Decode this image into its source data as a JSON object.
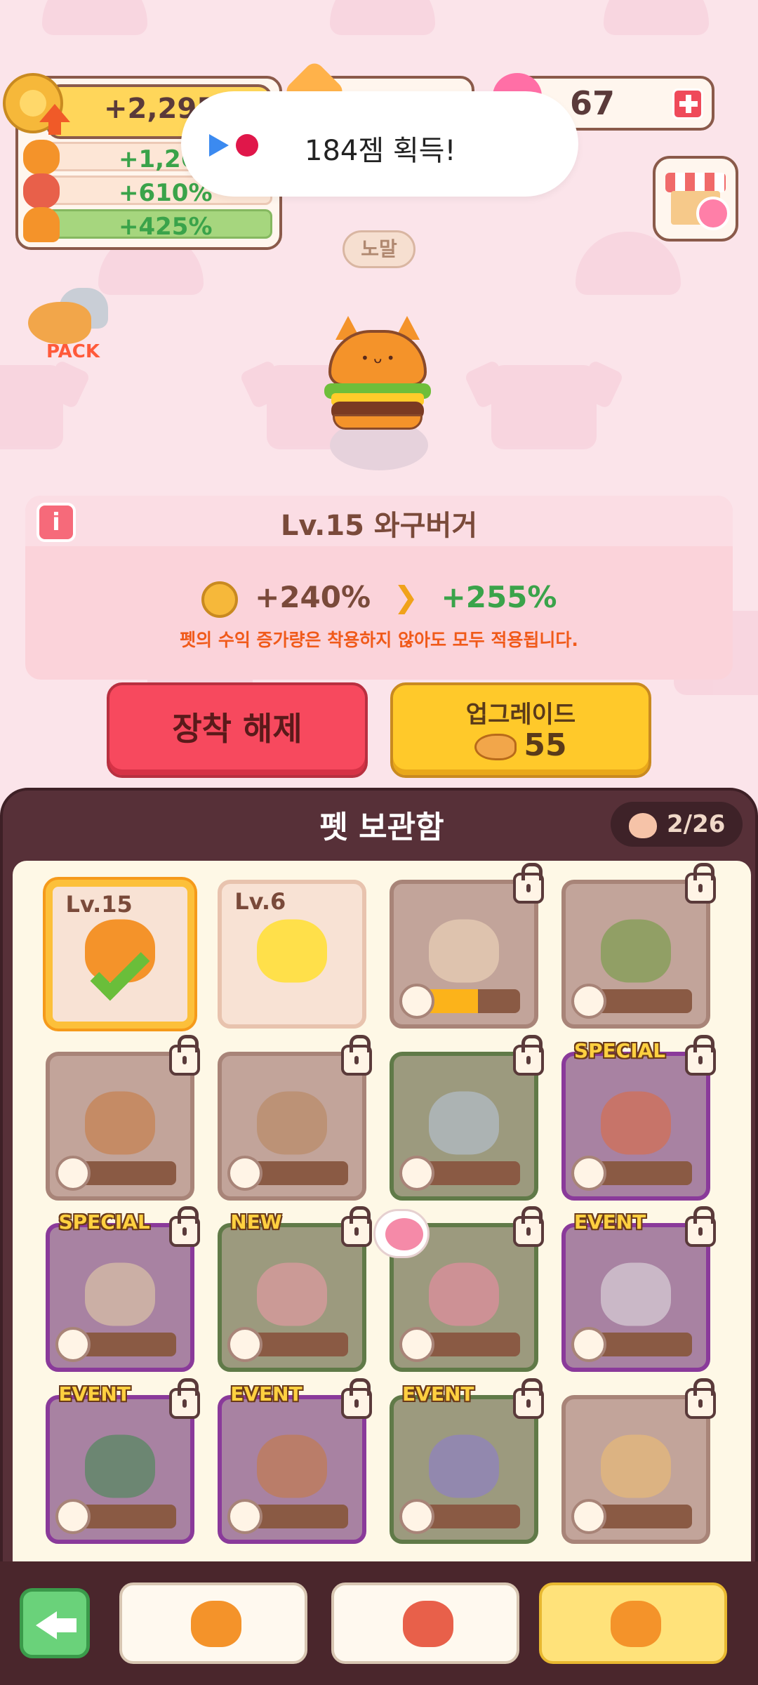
{
  "header": {
    "coin_total": "+2,295%",
    "bonuses": [
      {
        "pet": "cat-green-scarf",
        "value": "+1,260%"
      },
      {
        "pet": "cat-red-hat",
        "value": "+610%"
      },
      {
        "pet": "wagyu-burger",
        "value": "+425%"
      }
    ],
    "hearts": "67"
  },
  "toast": {
    "text": "184젬 획득!"
  },
  "pack_label": "PACK",
  "grade": "노말",
  "pet_panel": {
    "title": "Lv.15 와구버거",
    "current_bonus": "+240%",
    "next_bonus": "+255%",
    "note": "펫의 수익 증가량은 착용하지 않아도 모두 적용됩니다."
  },
  "actions": {
    "unequip_label": "장착 해제",
    "upgrade_label": "업그레이드",
    "upgrade_cost": "55"
  },
  "storage": {
    "title": "펫 보관함",
    "count": "2/26",
    "cards": [
      {
        "name": "wagyu-burger",
        "level": "Lv.15",
        "state": "selected",
        "badge": ""
      },
      {
        "name": "lemon",
        "level": "Lv.6",
        "state": "unlocked",
        "badge": ""
      },
      {
        "name": "toast-bread",
        "level": "",
        "state": "locked",
        "badge": "",
        "progress": 0.6
      },
      {
        "name": "leaf",
        "level": "",
        "state": "locked",
        "badge": "",
        "progress": 0.1
      },
      {
        "name": "fried-cat",
        "level": "",
        "state": "locked",
        "badge": "",
        "progress": 0.05
      },
      {
        "name": "mushroom",
        "level": "",
        "state": "locked",
        "badge": "",
        "progress": 0.05
      },
      {
        "name": "popsicle",
        "level": "",
        "state": "locked-green",
        "badge": "",
        "progress": 0.02
      },
      {
        "name": "octopus",
        "level": "",
        "state": "locked-purple",
        "badge": "SPECIAL",
        "progress": 0
      },
      {
        "name": "sandwich",
        "level": "",
        "state": "locked-purple",
        "badge": "SPECIAL",
        "progress": 0
      },
      {
        "name": "snail-roll",
        "level": "",
        "state": "locked-green",
        "badge": "NEW",
        "progress": 0
      },
      {
        "name": "peach",
        "level": "",
        "state": "locked-green",
        "badge": "",
        "progress": 0
      },
      {
        "name": "ghost-cat",
        "level": "",
        "state": "locked-purple",
        "badge": "EVENT",
        "progress": 0
      },
      {
        "name": "christmas-tree",
        "level": "",
        "state": "locked-purple",
        "badge": "EVENT",
        "progress": 0
      },
      {
        "name": "coin-cookie",
        "level": "",
        "state": "locked-purple",
        "badge": "EVENT",
        "progress": 0
      },
      {
        "name": "purple-cloud",
        "level": "",
        "state": "locked-green",
        "badge": "EVENT",
        "progress": 0
      },
      {
        "name": "pizza",
        "level": "",
        "state": "locked",
        "badge": "",
        "progress": 0
      }
    ]
  },
  "colors": {
    "accent_red": "#f7495e",
    "accent_yellow": "#ffc92a",
    "panel_dark": "#573038"
  }
}
